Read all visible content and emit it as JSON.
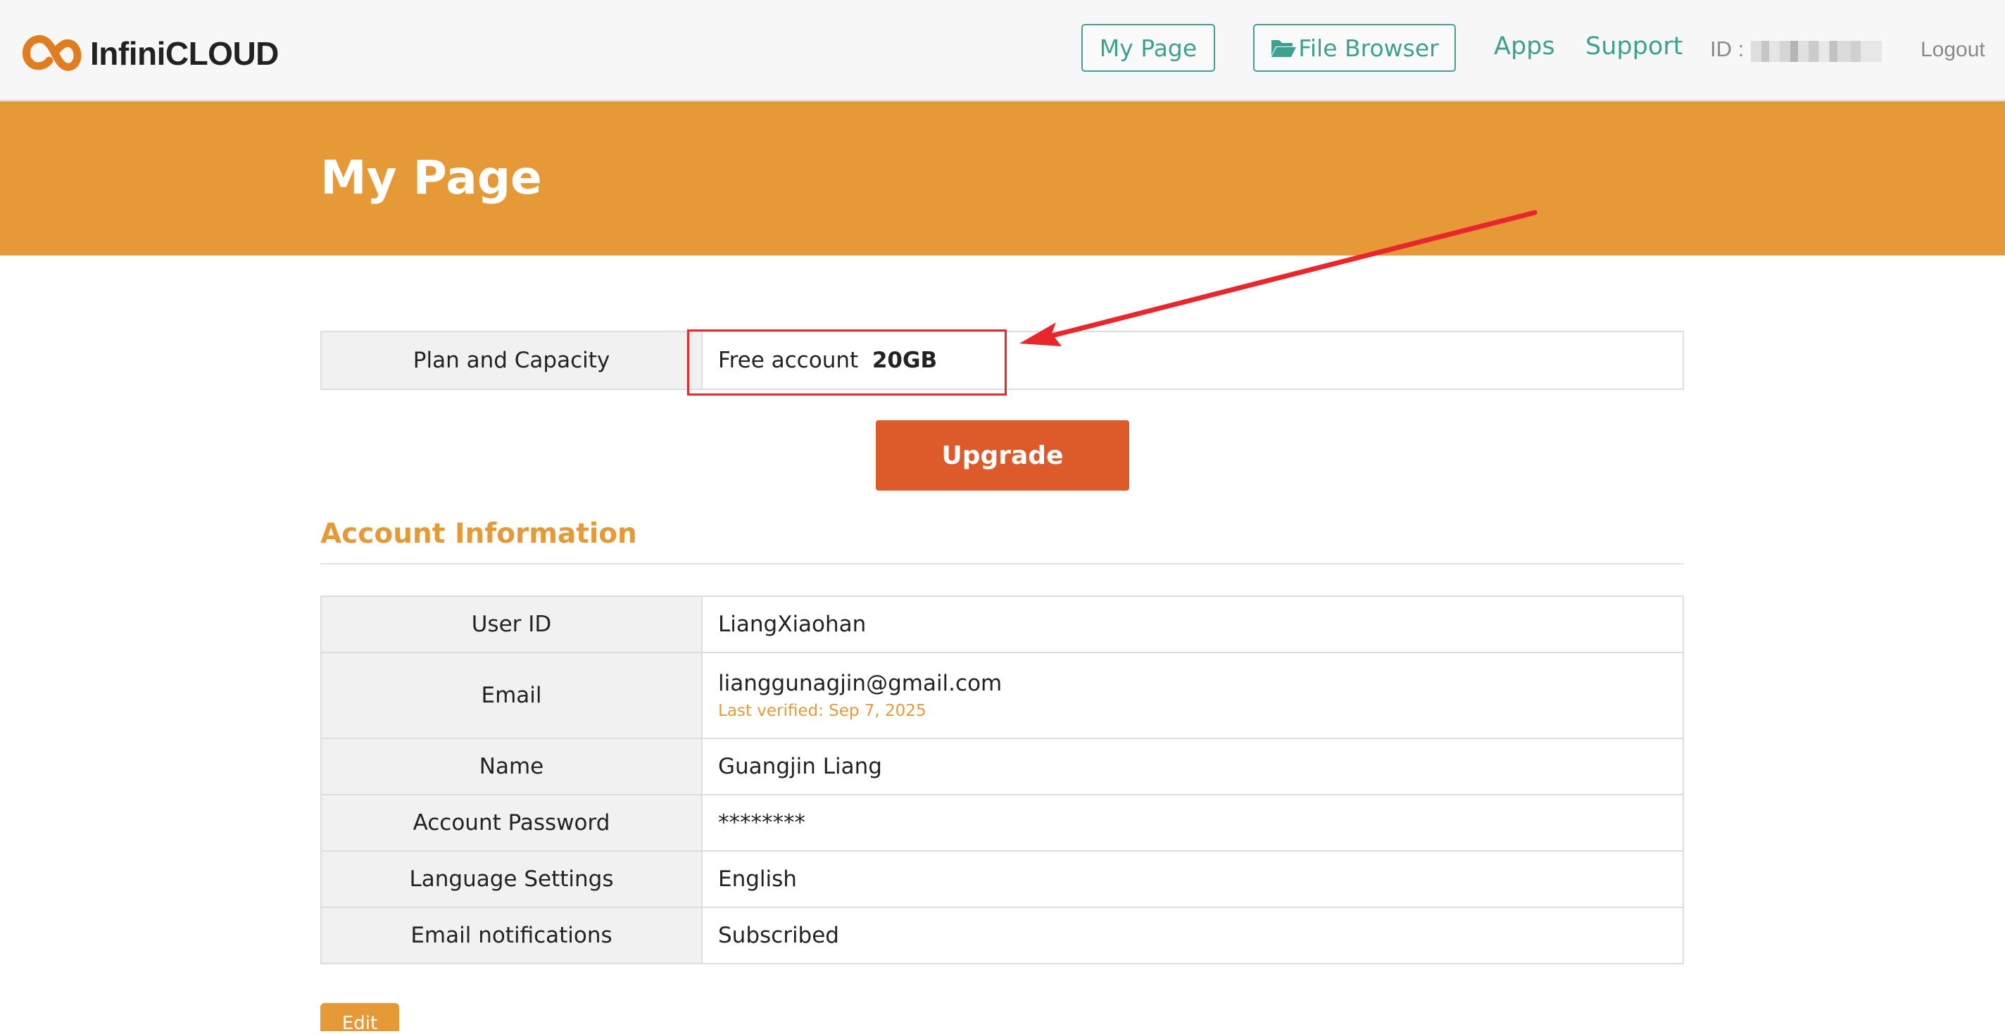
{
  "header": {
    "logo_text": "InfiniCLOUD",
    "nav": {
      "my_page": "My Page",
      "file_browser": "File Browser",
      "apps": "Apps",
      "support": "Support",
      "id_label": "ID :",
      "logout": "Logout"
    }
  },
  "banner": {
    "title": "My Page"
  },
  "plan": {
    "label": "Plan and Capacity",
    "plan_name": "Free account",
    "capacity": "20GB",
    "upgrade_label": "Upgrade"
  },
  "account": {
    "section_title": "Account Information",
    "rows": [
      {
        "label": "User ID",
        "value": "LiangXiaohan"
      },
      {
        "label": "Email",
        "value": "lianggunagjin@gmail.com",
        "note": "Last verified: Sep 7, 2025"
      },
      {
        "label": "Name",
        "value": "Guangjin Liang"
      },
      {
        "label": "Account Password",
        "value": "********"
      },
      {
        "label": "Language Settings",
        "value": "English"
      },
      {
        "label": "Email notifications",
        "value": "Subscribed"
      }
    ],
    "edit_label": "Edit"
  },
  "colors": {
    "accent_orange": "#e59a37",
    "upgrade_orange": "#dd5a2b",
    "nav_teal": "#3ea091",
    "annotation_red": "#e8262b"
  },
  "icons": {
    "logo": "infinity-loop-icon",
    "file_browser": "folder-open-icon",
    "annotation": "red-arrow-icon"
  }
}
